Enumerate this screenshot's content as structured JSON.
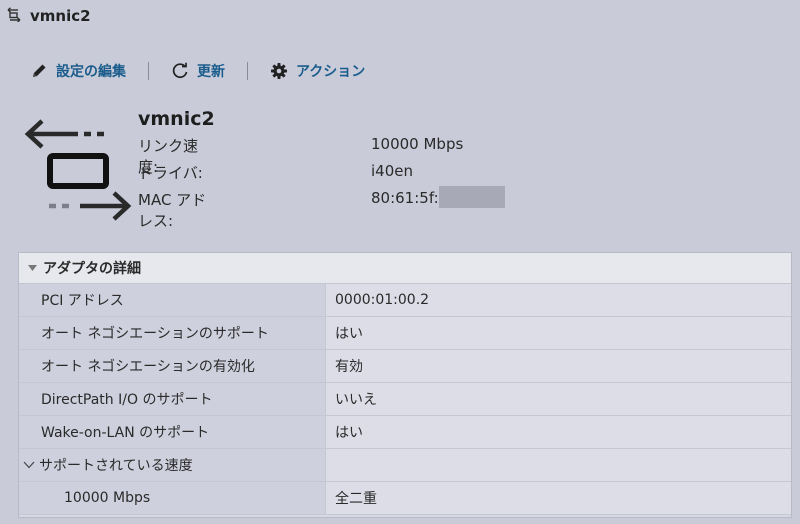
{
  "window": {
    "title": "vmnic2"
  },
  "toolbar": {
    "edit_label": "設定の編集",
    "refresh_label": "更新",
    "actions_label": "アクション"
  },
  "summary": {
    "name": "vmnic2",
    "rows": [
      {
        "label": "リンク速度:",
        "value": "10000 Mbps"
      },
      {
        "label": "ドライバ:",
        "value": "i40en"
      },
      {
        "label": "MAC アドレス:",
        "value": "80:61:5f:"
      }
    ]
  },
  "details": {
    "header": "アダプタの詳細",
    "rows": [
      {
        "label": "PCI アドレス",
        "value": "0000:01:00.2"
      },
      {
        "label": "オート ネゴシエーションのサポート",
        "value": "はい"
      },
      {
        "label": "オート ネゴシエーションの有効化",
        "value": "有効"
      },
      {
        "label": "DirectPath I/O のサポート",
        "value": "いいえ"
      },
      {
        "label": "Wake-on-LAN のサポート",
        "value": "はい"
      }
    ],
    "speed_group": {
      "label": "サポートされている速度",
      "rows": [
        {
          "label": "10000 Mbps",
          "value": "全二重"
        }
      ]
    }
  },
  "colors": {
    "accent": "#1a5c8c",
    "background": "#c9cbd8"
  }
}
